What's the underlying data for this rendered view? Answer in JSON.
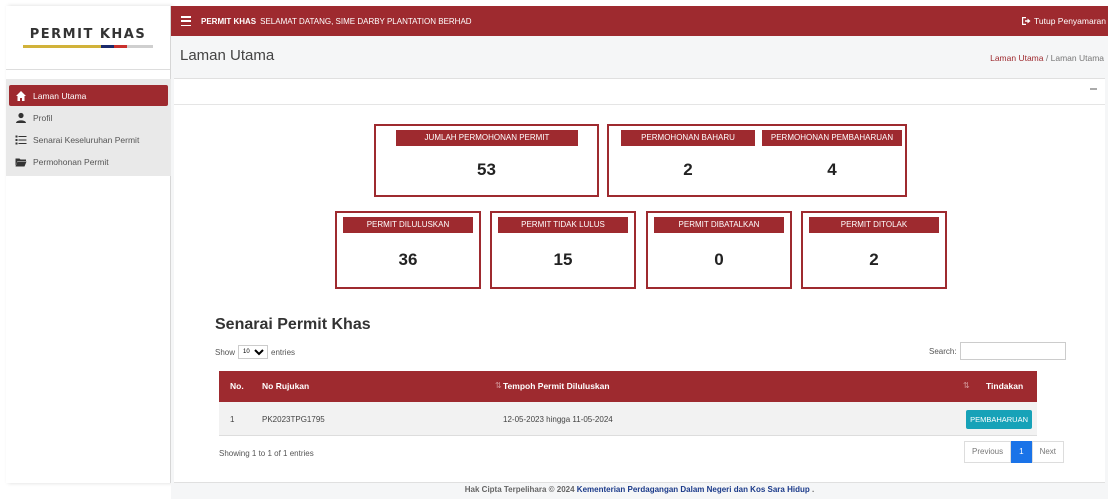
{
  "brand": {
    "name": "PERMIT KHAS"
  },
  "sidebar": {
    "items": [
      {
        "label": "Laman Utama",
        "icon": "home-icon",
        "active": true
      },
      {
        "label": "Profil",
        "icon": "user-icon",
        "active": false
      },
      {
        "label": "Senarai Keseluruhan Permit",
        "icon": "list-icon",
        "active": false
      },
      {
        "label": "Permohonan Permit",
        "icon": "folder-icon",
        "active": false
      }
    ]
  },
  "topbar": {
    "app": "PERMIT KHAS",
    "welcome": "SELAMAT DATANG, SIME DARBY PLANTATION BERHAD",
    "logout": "Tutup Penyamaran"
  },
  "header": {
    "title": "Laman Utama",
    "breadcrumb": [
      "Laman Utama",
      "/",
      "Laman Utama"
    ]
  },
  "stats": {
    "total": {
      "label": "JUMLAH PERMOHONAN PERMIT",
      "value": "53"
    },
    "baharu": {
      "label": "PERMOHONAN BAHARU",
      "value": "2"
    },
    "pembaharuan": {
      "label": "PERMOHONAN PEMBAHARUAN",
      "value": "4"
    },
    "diluluskan": {
      "label": "PERMIT DILULUSKAN",
      "value": "36"
    },
    "tidak_lulus": {
      "label": "PERMIT TIDAK LULUS",
      "value": "15"
    },
    "dibatalkan": {
      "label": "PERMIT DIBATALKAN",
      "value": "0"
    },
    "ditolak": {
      "label": "PERMIT DITOLAK",
      "value": "2"
    }
  },
  "table": {
    "title": "Senarai Permit Khas",
    "show_prefix": "Show",
    "show_value": "10",
    "show_suffix": "entries",
    "search_label": "Search:",
    "columns": [
      "No.",
      "No Rujukan",
      "Tempoh Permit Diluluskan",
      "Tindakan"
    ],
    "rows": [
      {
        "no": "1",
        "ref": "PK2023TPG1795",
        "period": "12-05-2023 hingga 11-05-2024",
        "action": "PEMBAHARUAN"
      }
    ],
    "info": "Showing 1 to 1 of 1 entries",
    "pager": {
      "prev": "Previous",
      "page": "1",
      "next": "Next"
    }
  },
  "footer": {
    "prefix": "Hak Cipta Terpelihara © 2024",
    "ministry": "Kementerian Perdagangan Dalam Negeri dan Kos Sara Hidup",
    "suffix": "."
  },
  "colors": {
    "accent": "#9e2a2f",
    "info": "#17a2b8",
    "pager_active": "#1a73e8"
  }
}
